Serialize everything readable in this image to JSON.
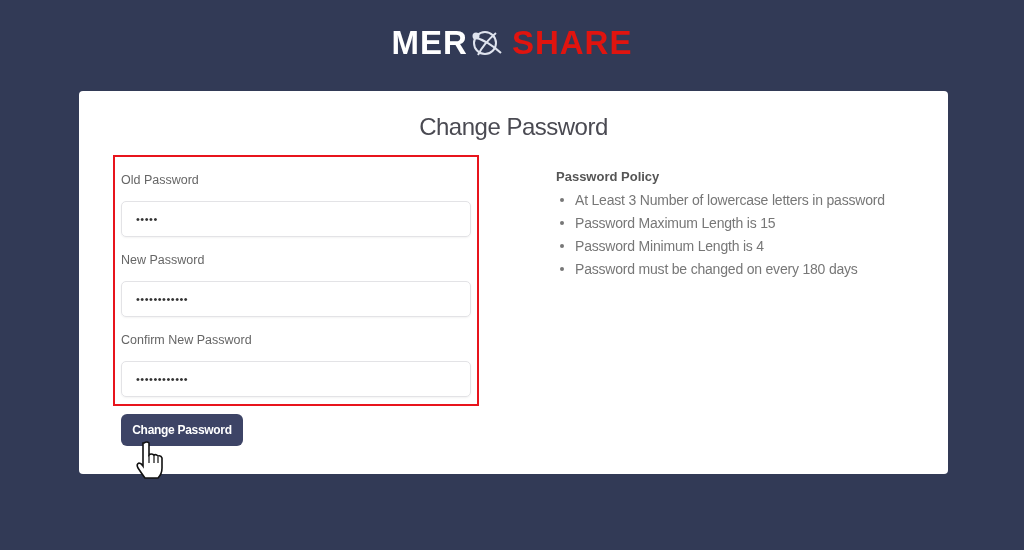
{
  "logo": {
    "left": "MER",
    "right": "SHARE"
  },
  "card": {
    "title": "Change Password"
  },
  "form": {
    "highlighted": true,
    "fields": [
      {
        "label": "Old Password",
        "value": "•••••"
      },
      {
        "label": "New Password",
        "value": "••••••••••••"
      },
      {
        "label": "Confirm New Password",
        "value": "••••••••••••"
      }
    ],
    "submit": "Change Password"
  },
  "policy": {
    "title": "Password Policy",
    "items": [
      "At Least 3 Number of lowercase letters in password",
      "Password Maximum Length is 15",
      "Password Minimum Length is 4",
      "Password must be changed on every 180 days"
    ]
  }
}
